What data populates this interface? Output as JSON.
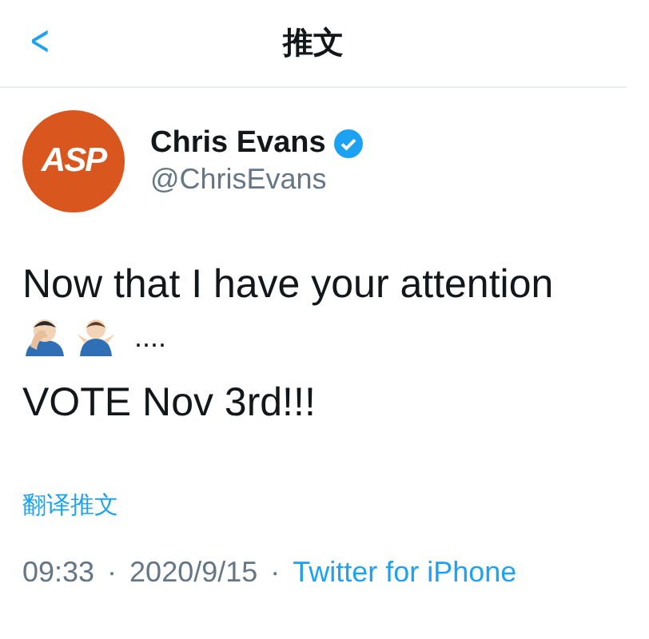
{
  "header": {
    "back": "<",
    "title": "推文"
  },
  "author": {
    "avatar_logo": "ASP",
    "name": "Chris Evans",
    "verified": true,
    "handle": "@ChrisEvans"
  },
  "tweet": {
    "line_1": "Now that I have your attention",
    "trail": "....",
    "line_2": "VOTE Nov 3rd!!!"
  },
  "translate_link": "翻译推文",
  "meta": {
    "time": "09:33",
    "separator_1": "·",
    "date": "2020/9/15",
    "separator_2": "·",
    "source": "Twitter for iPhone"
  }
}
